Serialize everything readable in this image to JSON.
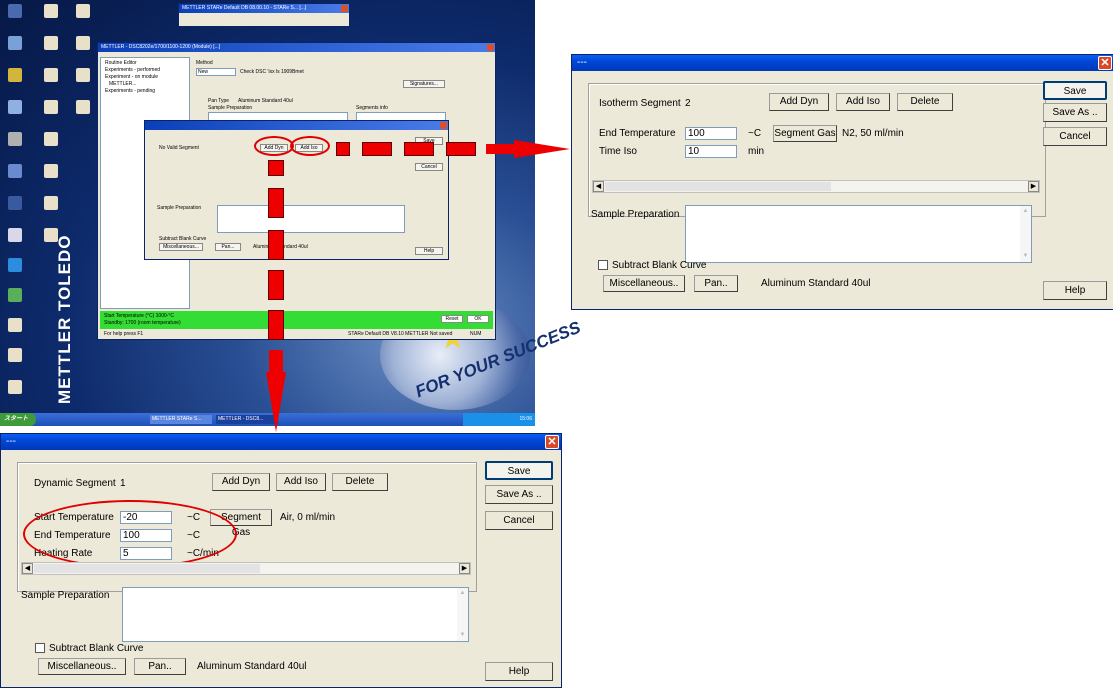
{
  "desktop": {
    "logo_text": "METTLER TOLEDO",
    "seal_text": "FOR YOUR SUCCESS",
    "start_label": "スタート",
    "taskbar_items": [
      "METTLER STARe S...",
      "METTLER - DSC8..."
    ],
    "tray_time": "15:06",
    "top_window_title": "METTLER STARe Default DB 08.00.10 - STARe S... [...]",
    "main_window": {
      "title": "METTLER - DSC8202e/1700/1100-1200 (Module) [...]",
      "tree": [
        "Routine Editor",
        "Experiments - performed",
        "Experiment - on module",
        "METTLER...",
        "Experiments - pending"
      ],
      "method_label": "Method",
      "method_value": "New",
      "method_desc": "Check DSC 'ixx ls 1909Bmet",
      "signatures": "Signatures...",
      "pan_type_label": "Pan Type",
      "pan_type_value": "Aluminum Standard 40ul",
      "sample_prep_label": "Sample Preparation",
      "segments_info_label": "Segments info",
      "status_line1": "Start Temperature (°C)   1000-°C",
      "status_line2": "Standby: 1700 (room temperature)",
      "reset": "Reset",
      "ok": "OK",
      "footer_help": "For help press F1",
      "footer_db": "STARe Default DB V8.10 METTLER Not saved",
      "footer_num": "NUM"
    },
    "mini_dialog": {
      "no_valid_segment": "No Valid Segment",
      "add_dyn": "Add Dyn",
      "add_iso": "Add Iso",
      "save": "Save",
      "cancel": "Cancel",
      "sample_prep": "Sample Preparation",
      "subtract": "Subtract Blank Curve",
      "misc": "Miscellaneous...",
      "pan": "Pan...",
      "pan_value": "Aluminum Standard 40ul",
      "help": "Help"
    }
  },
  "iso_dialog": {
    "title": "---",
    "segment_label": "Isotherm Segment",
    "segment_number": "2",
    "add_dyn": "Add Dyn",
    "add_iso": "Add Iso",
    "delete": "Delete",
    "save": "Save",
    "save_as": "Save As ..",
    "cancel": "Cancel",
    "end_temp_label": "End Temperature",
    "end_temp_value": "100",
    "end_temp_unit": "~C",
    "time_iso_label": "Time Iso",
    "time_iso_value": "10",
    "time_iso_unit": "min",
    "segment_gas": "Segment Gas",
    "gas_value": "N2, 50 ml/min",
    "sample_prep_label": "Sample Preparation",
    "subtract_label": "Subtract Blank Curve",
    "misc": "Miscellaneous..",
    "pan": "Pan..",
    "pan_value": "Aluminum Standard 40ul",
    "help": "Help"
  },
  "dyn_dialog": {
    "title": "---",
    "segment_label": "Dynamic Segment",
    "segment_number": "1",
    "add_dyn": "Add Dyn",
    "add_iso": "Add Iso",
    "delete": "Delete",
    "save": "Save",
    "save_as": "Save As ..",
    "cancel": "Cancel",
    "start_temp_label": "Start Temperature",
    "start_temp_value": "-20",
    "start_temp_unit": "~C",
    "end_temp_label": "End Temperature",
    "end_temp_value": "100",
    "end_temp_unit": "~C",
    "rate_label": "Heating Rate",
    "rate_value": "5",
    "rate_unit": "~C/min",
    "segment_gas": "Segment Gas",
    "gas_value": "Air, 0 ml/min",
    "sample_prep_label": "Sample Preparation",
    "subtract_label": "Subtract Blank Curve",
    "misc": "Miscellaneous..",
    "pan": "Pan..",
    "pan_value": "Aluminum Standard 40ul",
    "help": "Help"
  },
  "colors": {
    "annotation": "#ee0000",
    "titlebar": "#0047d6",
    "dialog_bg": "#ece9d8",
    "status_green": "#33dd33"
  }
}
